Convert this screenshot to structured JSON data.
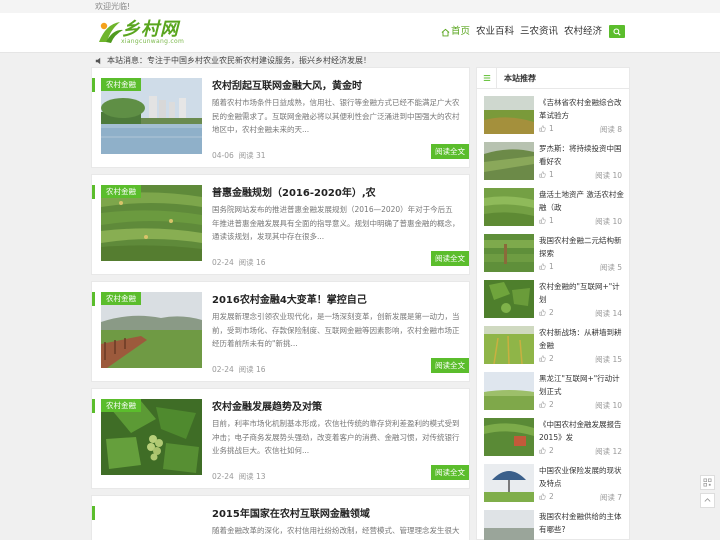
{
  "topbar": {
    "welcome": "欢迎光临!"
  },
  "site": {
    "logo_text": "乡村网",
    "logo_sub": "xiangcunwang.com"
  },
  "nav": {
    "items": [
      {
        "label": "首页",
        "active": true
      },
      {
        "label": "农业百科",
        "active": false
      },
      {
        "label": "三农资讯",
        "active": false
      },
      {
        "label": "农村经济",
        "active": false
      }
    ]
  },
  "notice": {
    "text": "本站消息：专注于中国乡村农业农民新农村建设服务，振兴乡村经济发展！"
  },
  "articles": [
    {
      "category": "农村金融",
      "title": "农村刮起互联网金融大风，黄金时",
      "excerpt": "随着农村市场条件日益成熟，信用社、银行等金融方式已经不能满足广大农民的金融需求了。互联网金融必将以其便利性会广泛涌进到中国强大的农村地区中，农村金融未来的天...",
      "date": "04-06",
      "reads": "阅读 31",
      "button": "阅读全文"
    },
    {
      "category": "农村金融",
      "title": "普惠金融规划（2016-2020年）,农",
      "excerpt": "国务院网站发布的推进普惠金融发展规划（2016—2020）年对于今后五年推进普惠金融发展具有全面的指导意义。规划中明确了普惠金融的概念，通读该规划，发现其中存在很多...",
      "date": "02-24",
      "reads": "阅读 16",
      "button": "阅读全文"
    },
    {
      "category": "农村金融",
      "title": "2016农村金融4大变革！掌控自己",
      "excerpt": "用发展新理念引领农业现代化，是一场深刻变革，创新发展是第一动力，当前，受到市场化、存款保险制度、互联网金融等因素影响，农村金融市场正经历着前所未有的\"新挑...",
      "date": "02-24",
      "reads": "阅读 16",
      "button": "阅读全文"
    },
    {
      "category": "农村金融",
      "title": "农村金融发展趋势及对策",
      "excerpt": "目前，利率市场化机制基本形成，农信社传统的靠存贷利差盈利的模式受到冲击；电子商务发展势头强劲，改变着客户的消费、金融习惯，对传统银行业务挑战巨大。农信社如何...",
      "date": "02-24",
      "reads": "阅读 13",
      "button": "阅读全文"
    },
    {
      "category": "",
      "title": "2015年国家在农村互联网金融领域",
      "excerpt": "随着金融改革的深化，农村信用社纷纷改制，经营模式、管理理念发生很大变化，越来越多的农村互联网金融",
      "date": "",
      "reads": "",
      "button": ""
    }
  ],
  "sidebar": {
    "title": "本站推荐",
    "items": [
      {
        "title": "《吉林省农村金融综合改革试验方",
        "likes": "1",
        "reads": "阅读 8"
      },
      {
        "title": "罗杰斯：将持续投资中国看好农",
        "likes": "1",
        "reads": "阅读 10"
      },
      {
        "title": "盘活土地资产 激活农村金融（政",
        "likes": "1",
        "reads": "阅读 10"
      },
      {
        "title": "我国农村金融二元结构新探索",
        "likes": "1",
        "reads": "阅读 5"
      },
      {
        "title": "农村金融的\"互联网+\"计划",
        "likes": "2",
        "reads": "阅读 14"
      },
      {
        "title": "农村新战场：从耕墙到耕金融",
        "likes": "2",
        "reads": "阅读 15"
      },
      {
        "title": "黑龙江\"互联网+\"行动计划正式",
        "likes": "2",
        "reads": "阅读 10"
      },
      {
        "title": "《中国农村金融发展报告2015》发",
        "likes": "2",
        "reads": "阅读 12"
      },
      {
        "title": "中国农业保险发展的现状及特点",
        "likes": "2",
        "reads": "阅读 7"
      },
      {
        "title": "我国农村金融供给的主体有哪些?",
        "likes": "",
        "reads": ""
      }
    ]
  },
  "colors": {
    "accent": "#5bbd2c",
    "text": "#333333",
    "muted": "#999999"
  }
}
